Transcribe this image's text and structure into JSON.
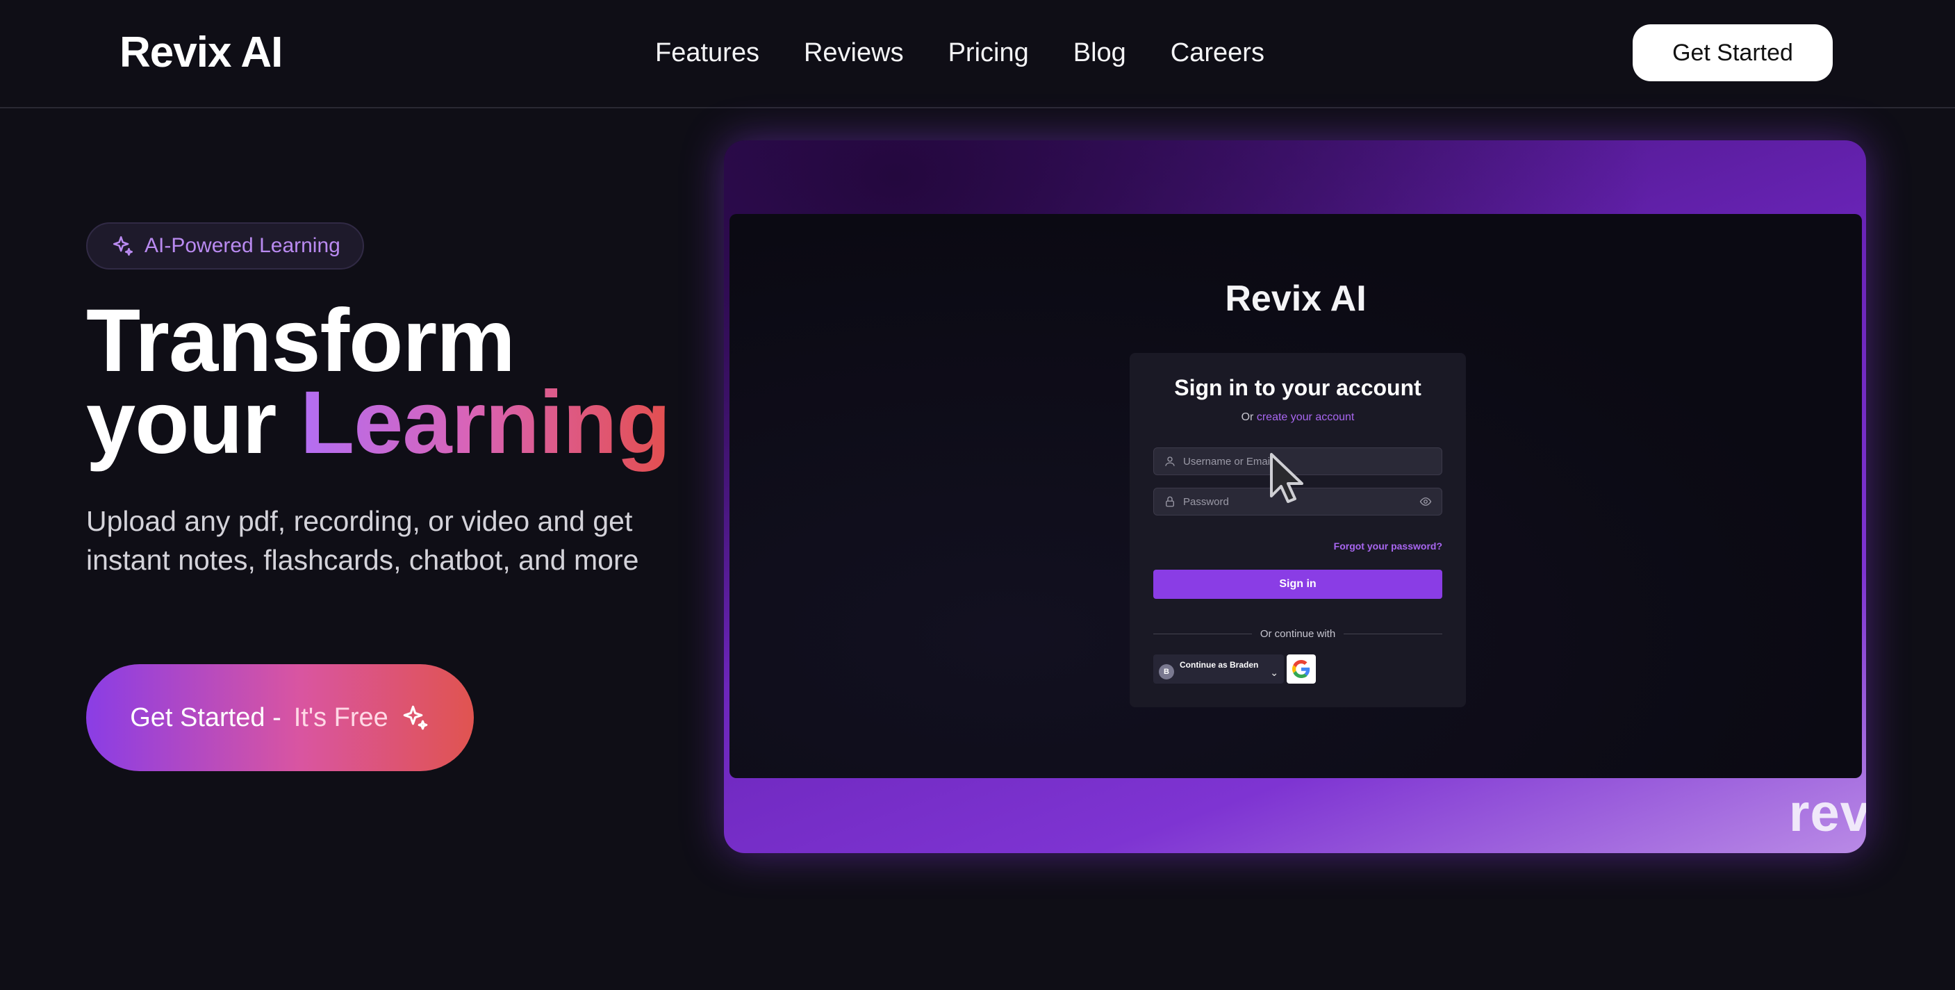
{
  "nav": {
    "logo": "Revix AI",
    "links": [
      "Features",
      "Reviews",
      "Pricing",
      "Blog",
      "Careers"
    ],
    "cta": "Get Started"
  },
  "hero": {
    "badge": "AI-Powered Learning",
    "headline_line1": "Transform",
    "headline_your": "your",
    "headline_highlight": "Learning",
    "subhead": "Upload any pdf, recording, or video and get instant notes, flashcards, chatbot, and more",
    "cta_main": "Get Started -",
    "cta_free": "It's Free"
  },
  "preview": {
    "app_title": "Revix AI",
    "card_title": "Sign in to your account",
    "card_sub_prefix": "Or",
    "card_sub_link": "create your account",
    "username_placeholder": "Username or Email",
    "password_placeholder": "Password",
    "forgot": "Forgot your password?",
    "sign_in": "Sign in",
    "divider": "Or continue with",
    "google_account": "Continue as Braden",
    "avatar_initial": "B",
    "wordmark": "rev"
  },
  "colors": {
    "accent": "#8a3de5",
    "gradient_start": "#b36ef3",
    "gradient_end": "#e34f4f",
    "background": "#0f0e16"
  }
}
